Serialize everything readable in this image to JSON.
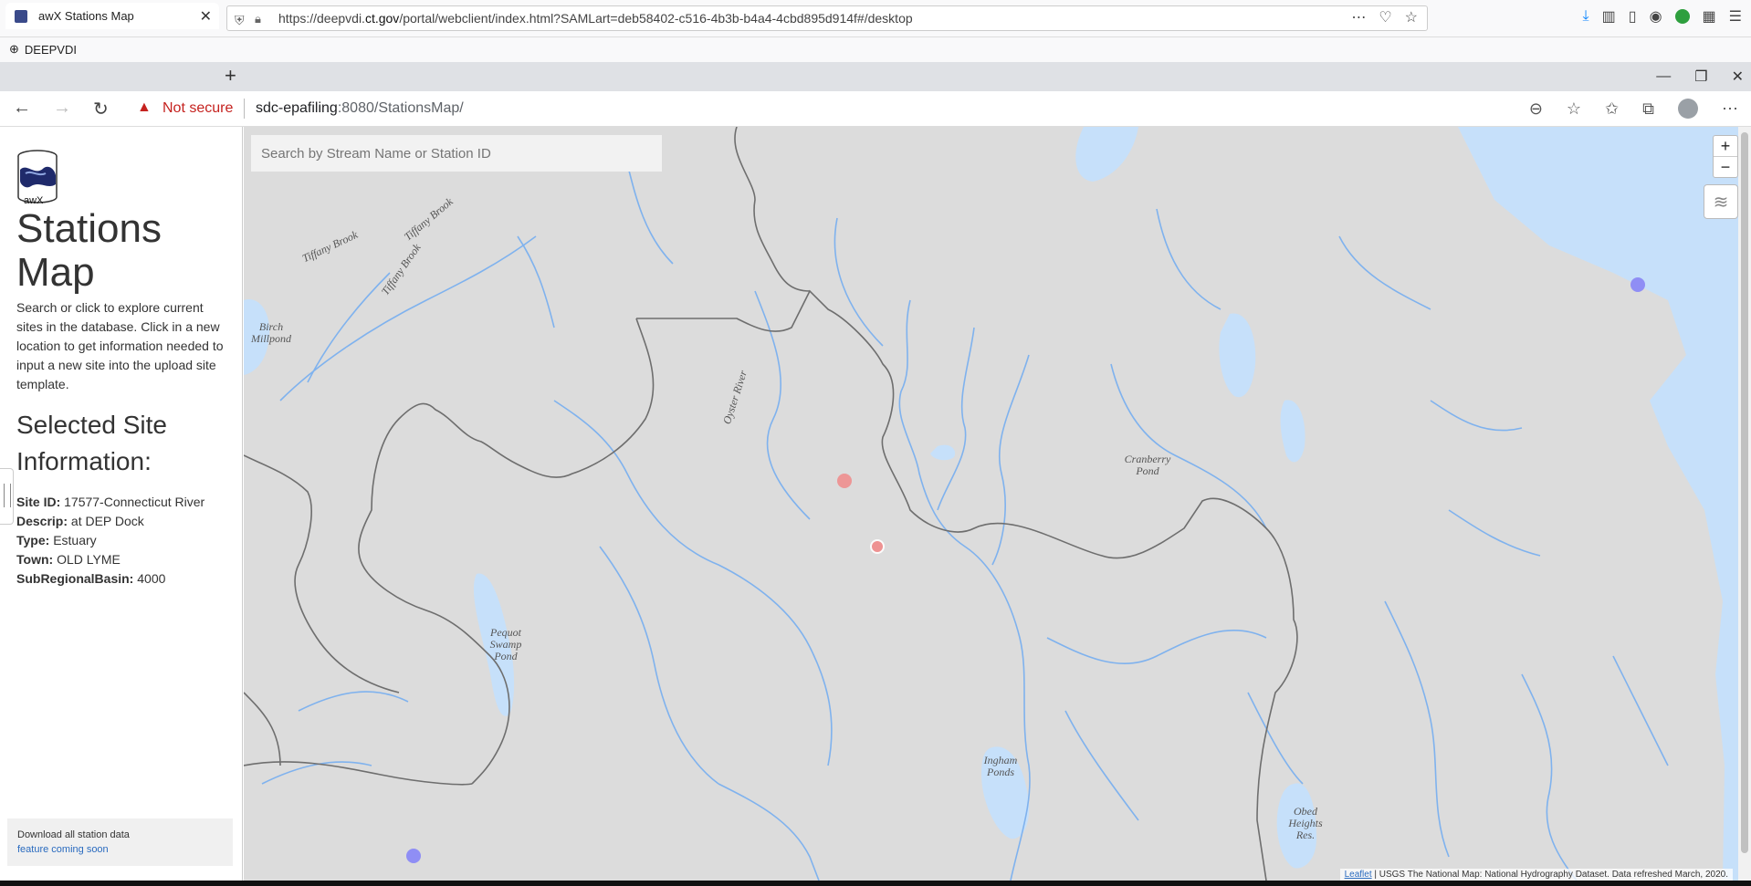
{
  "outer_browser": {
    "url_prefix": "https://deepvdi.",
    "url_host": "ct.gov",
    "url_rest": "/portal/webclient/index.html?SAMLart=deb58402-c516-4b3b-b4a4-4cbd895d914f#/desktop",
    "bookmark": "DEEPVDI"
  },
  "inner_browser": {
    "tab_title": "awX Stations Map",
    "security_label": "Not secure",
    "url_host": "sdc-epafiling",
    "url_rest": ":8080/StationsMap/"
  },
  "sidebar": {
    "logo_text": "awX",
    "title": "Stations Map",
    "description": "Search or click to explore current sites in the database. Click in a new location to get information needed to input a new site into the upload site template.",
    "selected_heading": "Selected Site Information:",
    "fields": {
      "site_id_label": "Site ID:",
      "site_id": "17577-Connecticut River",
      "descrip_label": "Descrip:",
      "descrip": "at DEP Dock",
      "type_label": "Type:",
      "type": "Estuary",
      "town_label": "Town:",
      "town": "OLD LYME",
      "basin_label": "SubRegionalBasin:",
      "basin": "4000"
    },
    "download_text": "Download all station data",
    "download_link": "feature coming soon"
  },
  "map": {
    "search_placeholder": "Search by Stream Name or Station ID",
    "zoom_in": "+",
    "zoom_out": "−",
    "labels": {
      "tiffany1": "Tiffany Brook",
      "tiffany2": "Tiffany Brook",
      "tiffany3": "Tiffany Brook",
      "birch": "Birch Millpond",
      "oyster": "Oyster River",
      "cranberry": "Cranberry Pond",
      "pequot": "Pequot Swamp Pond",
      "ingham": "Ingham Ponds",
      "obed": "Obed Heights Res."
    },
    "attribution_link": "Leaflet",
    "attribution_text": "| USGS The National Map: National Hydrography Dataset. Data refreshed March, 2020.",
    "colors": {
      "land": "#dcdcdc",
      "water": "#c6e0fa",
      "stream": "#7fb2ee",
      "boundary": "#6e6e6e",
      "marker_existing": "#8f8ef5",
      "marker_selected": "#f08a8a"
    }
  }
}
